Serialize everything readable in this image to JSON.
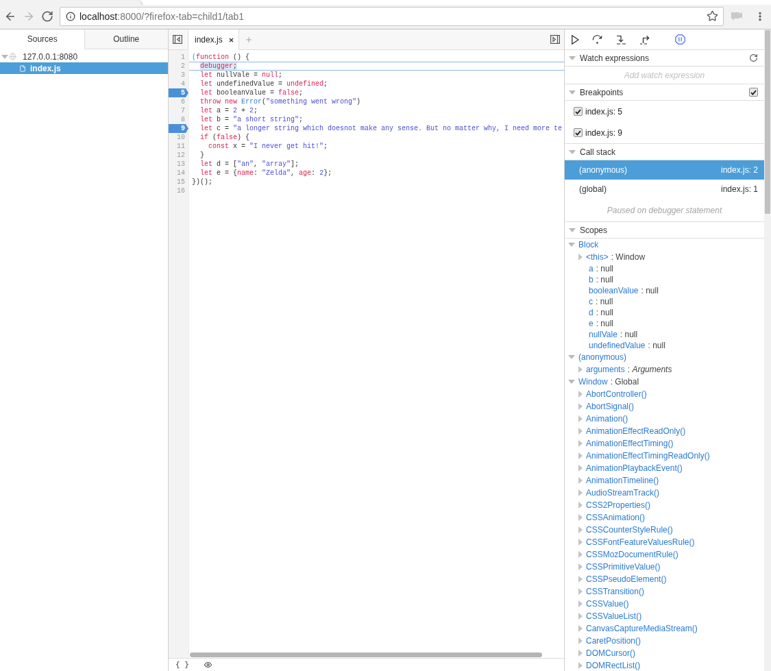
{
  "browser": {
    "nav_buttons": [
      {
        "kind": "back",
        "disabled": false
      },
      {
        "kind": "forward",
        "disabled": true
      },
      {
        "kind": "reload",
        "disabled": false
      }
    ],
    "address_bar": {
      "host": "localhost",
      "path": ":8000/?firefox-tab=child1/tab1"
    }
  },
  "sources_panel": {
    "tabs": [
      {
        "label": "Sources",
        "selected": true
      },
      {
        "label": "Outline",
        "selected": false
      }
    ],
    "tree": [
      {
        "label": "127.0.0.1:8080",
        "kind": "host",
        "expanded": true,
        "selected": false,
        "children": [
          {
            "label": "index.js",
            "kind": "file",
            "selected": true
          }
        ]
      }
    ]
  },
  "editor": {
    "tabs": [
      {
        "label": "index.js",
        "selected": true
      }
    ],
    "lines": [
      {
        "number": "1",
        "breakpoint": false,
        "paused": false,
        "tokens": [
          {
            "text": "(",
            "kind": "bracket"
          },
          {
            "text": "function",
            "kind": "keyword"
          },
          {
            "text": " () {",
            "kind": "plain"
          }
        ],
        "children": [
          {
            "number": "2",
            "breakpoint": false,
            "paused": true,
            "tokens": [
              {
                "text": "debugger",
                "kind": "keyword"
              },
              {
                "text": ";",
                "kind": "plain"
              }
            ]
          },
          {
            "number": "3",
            "breakpoint": false,
            "paused": false,
            "tokens": [
              {
                "text": "let",
                "kind": "keyword"
              },
              {
                "text": " nullVale = ",
                "kind": "plain"
              },
              {
                "text": "null",
                "kind": "keyword"
              },
              {
                "text": ";",
                "kind": "plain"
              }
            ]
          },
          {
            "number": "4",
            "breakpoint": false,
            "paused": false,
            "tokens": [
              {
                "text": "let",
                "kind": "keyword"
              },
              {
                "text": " undefinedValue = ",
                "kind": "plain"
              },
              {
                "text": "undefined",
                "kind": "keyword"
              },
              {
                "text": ";",
                "kind": "plain"
              }
            ]
          },
          {
            "number": "5",
            "breakpoint": true,
            "paused": false,
            "tokens": [
              {
                "text": "let",
                "kind": "keyword"
              },
              {
                "text": " booleanValue = ",
                "kind": "plain"
              },
              {
                "text": "false",
                "kind": "keyword"
              },
              {
                "text": ";",
                "kind": "plain"
              }
            ]
          },
          {
            "number": "6",
            "breakpoint": false,
            "paused": false,
            "tokens": [
              {
                "text": "throw",
                "kind": "keyword"
              },
              {
                "text": " new",
                "kind": "keyword"
              },
              {
                "text": " Error",
                "kind": "builtin"
              },
              {
                "text": "(",
                "kind": "plain"
              },
              {
                "text": "\"something went wrong\"",
                "kind": "string"
              },
              {
                "text": ")",
                "kind": "plain"
              }
            ]
          },
          {
            "number": "7",
            "breakpoint": false,
            "paused": false,
            "tokens": [
              {
                "text": "let",
                "kind": "keyword"
              },
              {
                "text": " a = ",
                "kind": "plain"
              },
              {
                "text": "2",
                "kind": "number"
              },
              {
                "text": " + ",
                "kind": "plain"
              },
              {
                "text": "2",
                "kind": "number"
              },
              {
                "text": ";",
                "kind": "plain"
              }
            ]
          },
          {
            "number": "8",
            "breakpoint": false,
            "paused": false,
            "tokens": [
              {
                "text": "let",
                "kind": "keyword"
              },
              {
                "text": " b = ",
                "kind": "plain"
              },
              {
                "text": "\"a short string\"",
                "kind": "string"
              },
              {
                "text": ";",
                "kind": "plain"
              }
            ]
          },
          {
            "number": "9",
            "breakpoint": true,
            "paused": false,
            "tokens": [
              {
                "text": "let",
                "kind": "keyword"
              },
              {
                "text": " c = ",
                "kind": "plain"
              },
              {
                "text": "\"a longer string which doesnot make any sense. But no matter why, I need more te",
                "kind": "string"
              }
            ]
          },
          {
            "number": "10",
            "breakpoint": false,
            "paused": false,
            "tokens": [
              {
                "text": "if",
                "kind": "keyword"
              },
              {
                "text": " (",
                "kind": "plain"
              },
              {
                "text": "false",
                "kind": "keyword"
              },
              {
                "text": ") {",
                "kind": "plain"
              }
            ],
            "children": [
              {
                "number": "11",
                "breakpoint": false,
                "paused": false,
                "tokens": [
                  {
                    "text": "const",
                    "kind": "keyword"
                  },
                  {
                    "text": " x = ",
                    "kind": "plain"
                  },
                  {
                    "text": "\"I never get hit!\"",
                    "kind": "string"
                  },
                  {
                    "text": ";",
                    "kind": "plain"
                  }
                ]
              }
            ]
          },
          {
            "number": "12",
            "breakpoint": false,
            "paused": false,
            "tokens": [
              {
                "text": "}",
                "kind": "plain"
              }
            ]
          },
          {
            "number": "13",
            "breakpoint": false,
            "paused": false,
            "tokens": [
              {
                "text": "let",
                "kind": "keyword"
              },
              {
                "text": " d = [",
                "kind": "plain"
              },
              {
                "text": "\"an\"",
                "kind": "string"
              },
              {
                "text": ", ",
                "kind": "plain"
              },
              {
                "text": "\"array\"",
                "kind": "string"
              },
              {
                "text": "];",
                "kind": "plain"
              }
            ]
          },
          {
            "number": "14",
            "breakpoint": false,
            "paused": false,
            "tokens": [
              {
                "text": "let",
                "kind": "keyword"
              },
              {
                "text": " e = {",
                "kind": "plain"
              },
              {
                "text": "name",
                "kind": "property"
              },
              {
                "text": ": ",
                "kind": "plain"
              },
              {
                "text": "\"Zelda\"",
                "kind": "string"
              },
              {
                "text": ", ",
                "kind": "plain"
              },
              {
                "text": "age",
                "kind": "property"
              },
              {
                "text": ": ",
                "kind": "plain"
              },
              {
                "text": "2",
                "kind": "number"
              },
              {
                "text": "};",
                "kind": "plain"
              }
            ]
          }
        ]
      },
      {
        "number": "15",
        "breakpoint": false,
        "paused": false,
        "tokens": [
          {
            "text": "})();",
            "kind": "plain"
          }
        ]
      },
      {
        "number": "16",
        "breakpoint": false,
        "paused": false
      }
    ],
    "footer": {
      "pretty_print": "{ }"
    }
  },
  "debugger": {
    "toolbar": [
      {
        "kind": "resume"
      },
      {
        "kind": "step_over"
      },
      {
        "kind": "step_in"
      },
      {
        "kind": "step_out"
      },
      {
        "kind": "pause_exceptions"
      }
    ],
    "watch": {
      "title": "Watch expressions",
      "expanded": true,
      "placeholder": "Add watch expression"
    },
    "breakpoints": {
      "title": "Breakpoints",
      "expanded": true,
      "all_enabled": true,
      "items": [
        {
          "label": "index.js: 5",
          "checked": true
        },
        {
          "label": "index.js: 9",
          "checked": true
        }
      ]
    },
    "call_stack": {
      "title": "Call stack",
      "expanded": true,
      "frames": [
        {
          "name": "(anonymous)",
          "location": "index.js: 2",
          "selected": true
        },
        {
          "name": "(global)",
          "location": "index.js: 1",
          "selected": false
        }
      ],
      "message": "Paused on debugger statement"
    },
    "scopes": {
      "title": "Scopes",
      "expanded": true,
      "tree": [
        {
          "name": "Block",
          "expanded": true,
          "children": [
            {
              "name": "<this>",
              "value": ": Window",
              "expanded": false
            },
            {
              "name": "a",
              "value": ": null"
            },
            {
              "name": "b",
              "value": ": null"
            },
            {
              "name": "booleanValue",
              "value": ": null"
            },
            {
              "name": "c",
              "value": ": null"
            },
            {
              "name": "d",
              "value": ": null"
            },
            {
              "name": "e",
              "value": ": null"
            },
            {
              "name": "nullVale",
              "value": ": null"
            },
            {
              "name": "undefinedValue",
              "value": ": null"
            }
          ]
        },
        {
          "name": "(anonymous)",
          "expanded": true,
          "children": [
            {
              "name": "arguments",
              "value": ": *Arguments*",
              "expanded": false
            }
          ]
        },
        {
          "name": "Window",
          "value": ": Global",
          "expanded": true,
          "children": [
            {
              "name": "AbortController()",
              "expanded": false
            },
            {
              "name": "AbortSignal()",
              "expanded": false
            },
            {
              "name": "Animation()",
              "expanded": false
            },
            {
              "name": "AnimationEffectReadOnly()",
              "expanded": false
            },
            {
              "name": "AnimationEffectTiming()",
              "expanded": false
            },
            {
              "name": "AnimationEffectTimingReadOnly()",
              "expanded": false
            },
            {
              "name": "AnimationPlaybackEvent()",
              "expanded": false
            },
            {
              "name": "AnimationTimeline()",
              "expanded": false
            },
            {
              "name": "AudioStreamTrack()",
              "expanded": false
            },
            {
              "name": "CSS2Properties()",
              "expanded": false
            },
            {
              "name": "CSSAnimation()",
              "expanded": false
            },
            {
              "name": "CSSCounterStyleRule()",
              "expanded": false
            },
            {
              "name": "CSSFontFeatureValuesRule()",
              "expanded": false
            },
            {
              "name": "CSSMozDocumentRule()",
              "expanded": false
            },
            {
              "name": "CSSPrimitiveValue()",
              "expanded": false
            },
            {
              "name": "CSSPseudoElement()",
              "expanded": false
            },
            {
              "name": "CSSTransition()",
              "expanded": false
            },
            {
              "name": "CSSValue()",
              "expanded": false
            },
            {
              "name": "CSSValueList()",
              "expanded": false
            },
            {
              "name": "CanvasCaptureMediaStream()",
              "expanded": false
            },
            {
              "name": "CaretPosition()",
              "expanded": false
            },
            {
              "name": "DOMCursor()",
              "expanded": false
            },
            {
              "name": "DOMRectList()",
              "expanded": false
            }
          ]
        }
      ]
    }
  }
}
